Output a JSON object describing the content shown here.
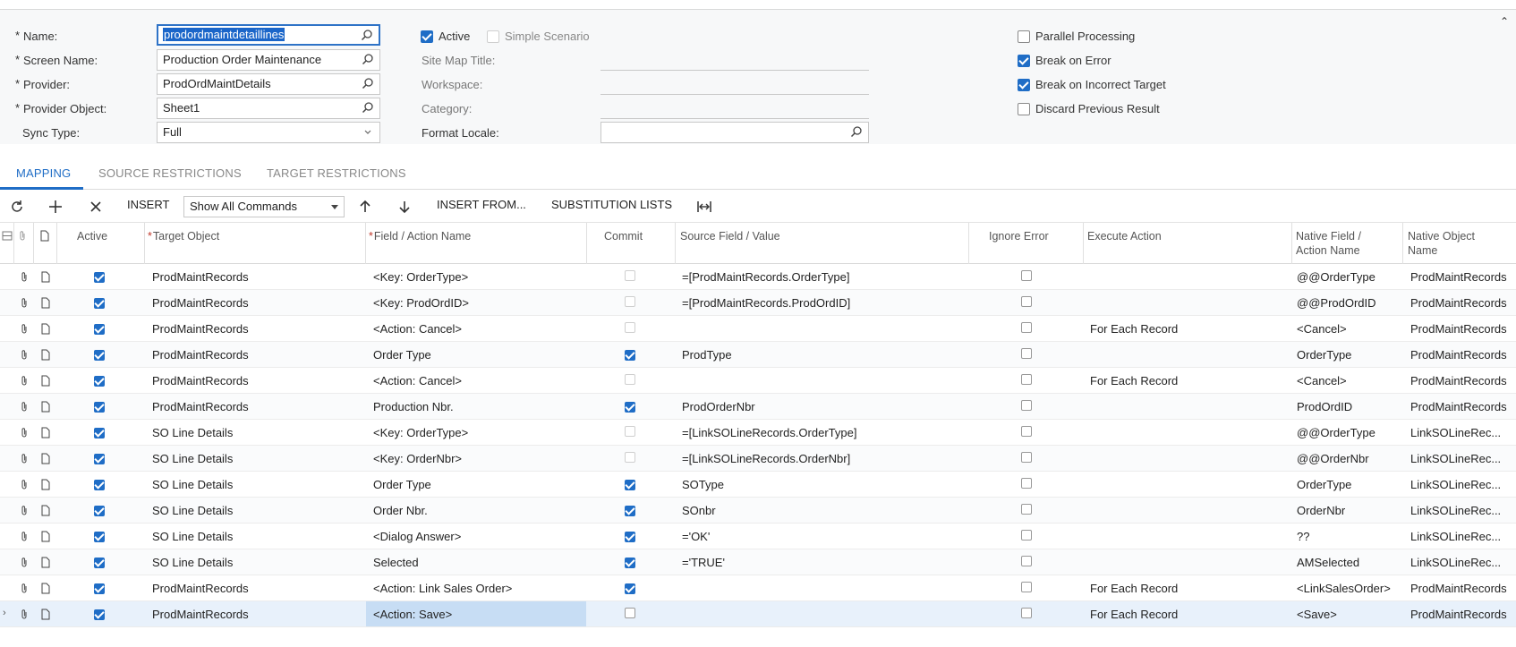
{
  "form": {
    "name_label": "Name:",
    "name_value": "prodordmaintdetaillines",
    "screen_name_label": "Screen Name:",
    "screen_name_value": "Production Order Maintenance",
    "provider_label": "Provider:",
    "provider_value": "ProdOrdMaintDetails",
    "provider_object_label": "Provider Object:",
    "provider_object_value": "Sheet1",
    "sync_type_label": "Sync Type:",
    "sync_type_value": "Full",
    "active_label": "Active",
    "simple_scenario_label": "Simple Scenario",
    "site_map_title_label": "Site Map Title:",
    "workspace_label": "Workspace:",
    "category_label": "Category:",
    "format_locale_label": "Format Locale:",
    "parallel_label": "Parallel Processing",
    "break_error_label": "Break on Error",
    "break_target_label": "Break on Incorrect Target",
    "discard_label": "Discard Previous Result"
  },
  "tabs": [
    "MAPPING",
    "SOURCE RESTRICTIONS",
    "TARGET RESTRICTIONS"
  ],
  "toolbar": {
    "insert": "INSERT",
    "filter": "Show All Commands",
    "insert_from": "INSERT FROM...",
    "substitution": "SUBSTITUTION LISTS"
  },
  "columns": {
    "active": "Active",
    "target_object": "Target Object",
    "field_action": "Field / Action Name",
    "commit": "Commit",
    "source_field": "Source Field / Value",
    "ignore_error": "Ignore Error",
    "execute_action": "Execute Action",
    "native_field_1": "Native Field /",
    "native_field_2": "Action Name",
    "native_object_1": "Native Object",
    "native_object_2": "Name"
  },
  "rows": [
    {
      "target": "ProdMaintRecords",
      "field": "<Key: OrderType>",
      "commit": "dis",
      "source": "=[ProdMaintRecords.OrderType]",
      "exec": "",
      "native_field": "@@OrderType",
      "native_obj": "ProdMaintRecords"
    },
    {
      "target": "ProdMaintRecords",
      "field": "<Key: ProdOrdID>",
      "commit": "dis",
      "source": "=[ProdMaintRecords.ProdOrdID]",
      "exec": "",
      "native_field": "@@ProdOrdID",
      "native_obj": "ProdMaintRecords"
    },
    {
      "target": "ProdMaintRecords",
      "field": "<Action: Cancel>",
      "commit": "dis",
      "source": "",
      "exec": "For Each Record",
      "native_field": "<Cancel>",
      "native_obj": "ProdMaintRecords"
    },
    {
      "target": "ProdMaintRecords",
      "field": "Order Type",
      "commit": "on",
      "source": "ProdType",
      "exec": "",
      "native_field": "OrderType",
      "native_obj": "ProdMaintRecords"
    },
    {
      "target": "ProdMaintRecords",
      "field": "<Action: Cancel>",
      "commit": "dis",
      "source": "",
      "exec": "For Each Record",
      "native_field": "<Cancel>",
      "native_obj": "ProdMaintRecords"
    },
    {
      "target": "ProdMaintRecords",
      "field": "Production Nbr.",
      "commit": "on",
      "source": "ProdOrderNbr",
      "exec": "",
      "native_field": "ProdOrdID",
      "native_obj": "ProdMaintRecords"
    },
    {
      "target": "SO Line Details",
      "field": "<Key: OrderType>",
      "commit": "dis",
      "source": "=[LinkSOLineRecords.OrderType]",
      "exec": "",
      "native_field": "@@OrderType",
      "native_obj": "LinkSOLineRec..."
    },
    {
      "target": "SO Line Details",
      "field": "<Key: OrderNbr>",
      "commit": "dis",
      "source": "=[LinkSOLineRecords.OrderNbr]",
      "exec": "",
      "native_field": "@@OrderNbr",
      "native_obj": "LinkSOLineRec..."
    },
    {
      "target": "SO Line Details",
      "field": "Order Type",
      "commit": "on",
      "source": "SOType",
      "exec": "",
      "native_field": "OrderType",
      "native_obj": "LinkSOLineRec..."
    },
    {
      "target": "SO Line Details",
      "field": "Order Nbr.",
      "commit": "on",
      "source": "SOnbr",
      "exec": "",
      "native_field": "OrderNbr",
      "native_obj": "LinkSOLineRec..."
    },
    {
      "target": "SO Line Details",
      "field": "<Dialog Answer>",
      "commit": "on",
      "source": "='OK'",
      "exec": "",
      "native_field": "??",
      "native_obj": "LinkSOLineRec..."
    },
    {
      "target": "SO Line Details",
      "field": "Selected",
      "commit": "on",
      "source": "='TRUE'",
      "exec": "",
      "native_field": "AMSelected",
      "native_obj": "LinkSOLineRec..."
    },
    {
      "target": "ProdMaintRecords",
      "field": "<Action: Link Sales Order>",
      "commit": "on",
      "source": "",
      "exec": "For Each Record",
      "native_field": "<LinkSalesOrder>",
      "native_obj": "ProdMaintRecords"
    },
    {
      "target": "ProdMaintRecords",
      "field": "<Action: Save>",
      "commit": "off",
      "source": "",
      "exec": "For Each Record",
      "native_field": "<Save>",
      "native_obj": "ProdMaintRecords"
    }
  ]
}
